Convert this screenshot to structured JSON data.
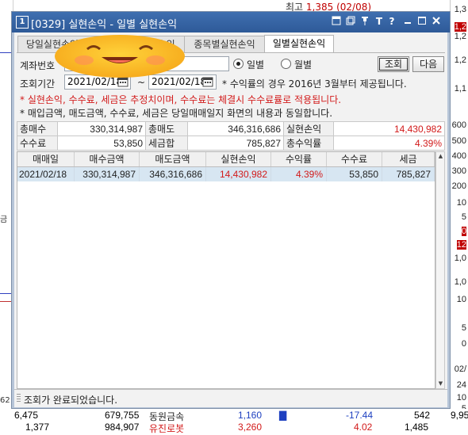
{
  "background": {
    "top_label": "최고",
    "top_value": "1,385 (02/08)",
    "right_ticks": [
      "1,3",
      "1,2",
      "1,2",
      "1,2",
      "1,1",
      "600",
      "500",
      "400",
      "300",
      "200",
      "10",
      "5",
      "0",
      "12",
      "1,0",
      "1,0",
      "10",
      "5",
      "0",
      "02/",
      "24",
      "10",
      "5",
      "9,95"
    ],
    "left_ticks": [
      "금",
      "62",
      "62"
    ],
    "bottom_rows": [
      {
        "c1": "6,475",
        "c2": "679,755",
        "name": "동원금속",
        "price": "1,160",
        "change": "-17.44",
        "vol": "542",
        "right": "9,95"
      },
      {
        "c1": "1,377",
        "c2": "984,907",
        "name": "유진로봇",
        "price": "3,260",
        "change": "4.02",
        "vol": "1,485",
        "right": ""
      }
    ]
  },
  "window": {
    "id": "[0329]",
    "title": "실현손익 - 일별 실현손익",
    "number": "1",
    "title_buttons": [
      "restore-icon",
      "copy-icon",
      "pin-icon",
      "font-icon",
      "help-icon",
      "minimize-icon",
      "maximize-icon",
      "close-icon"
    ],
    "title_glyphs": {
      "font": "T",
      "help": "?"
    }
  },
  "tabs": [
    {
      "label": "당일실현손익상세",
      "active": false
    },
    {
      "label": "종목별당일손익",
      "active": false
    },
    {
      "label": "종목별실현손익",
      "active": false
    },
    {
      "label": "일별실현손익",
      "active": true
    }
  ],
  "form": {
    "account_label": "계좌번호",
    "account_value": "",
    "period_label": "조회기간",
    "date_from": "2021/02/18",
    "date_sep": "~",
    "date_to": "2021/02/18",
    "radio_daily": "일별",
    "radio_monthly": "월별",
    "radio_selected": "일별",
    "query_button": "조회",
    "next_button": "다음",
    "info_note": "* 수익률의 경우 2016년 3월부터 제공됩니다.",
    "warning_note": "* 실현손익, 수수료, 세금은 추정치이며, 수수료는 체결시 수수료률로 적용됩니다.",
    "note2": "* 매입금액, 매도금액, 수수료, 세금은 당일매매일지 화면의 내용과 동일합니다."
  },
  "summary": {
    "row1": [
      {
        "label": "총매수",
        "value": "330,314,987"
      },
      {
        "label": "총매도",
        "value": "346,316,686"
      },
      {
        "label": "실현손익",
        "value": "14,430,982",
        "color": "#d21a1a"
      }
    ],
    "row2": [
      {
        "label": "수수료",
        "value": "53,850"
      },
      {
        "label": "세금합",
        "value": "785,827"
      },
      {
        "label": "총수익률",
        "value": "4.39%",
        "color": "#d21a1a"
      }
    ]
  },
  "grid": {
    "columns": [
      "매매일",
      "매수금액",
      "매도금액",
      "실현손익",
      "수익률",
      "수수료",
      "세금"
    ],
    "rows": [
      [
        "2021/02/18",
        "330,314,987",
        "346,316,686",
        "14,430,982",
        "4.39%",
        "53,850",
        "785,827"
      ]
    ]
  },
  "status": {
    "text": "조회가 완료되었습니다."
  },
  "colors": {
    "title_bar": "#2e5a98",
    "negative": "#d21a1a",
    "selected_row": "#d7e6f2"
  }
}
